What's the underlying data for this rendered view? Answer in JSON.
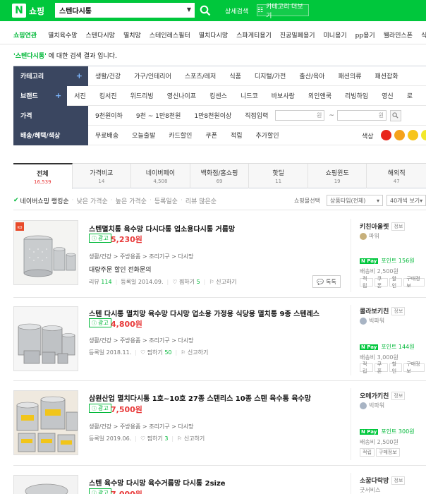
{
  "header": {
    "logo_text": "쇼핑",
    "search_query": "스텐다시통",
    "detail_search": "상세검색",
    "category_button": "카테고리 더보기"
  },
  "related": {
    "title": "쇼핑연관",
    "items": [
      "멸치육수망",
      "스텐다시망",
      "멸치망",
      "스테인레스필터",
      "멸치다시망",
      "스파게티용기",
      "진공밀폐용기",
      "미니용기",
      "pp용기",
      "웰라민스폰",
      "식품"
    ]
  },
  "result_message": {
    "query": "'스텐다시통'",
    "suffix": " 에 대한 검색 결과 입니다."
  },
  "filters": {
    "category": {
      "label": "카테고리",
      "items": [
        "생활/건강",
        "가구/인테리어",
        "스포츠/레저",
        "식품",
        "디지털/가전",
        "출산/육아",
        "패션의류",
        "패션잡화"
      ]
    },
    "brand": {
      "label": "브랜드",
      "items": [
        "서진",
        "킹서진",
        "위드리빙",
        "영신나이프",
        "킹센스",
        "니드코",
        "바보사랑",
        "외인앤쿡",
        "리빙하임",
        "영신",
        "로"
      ]
    },
    "price": {
      "label": "가격",
      "items": [
        "9천원이하",
        "9천 ~ 1만8천원",
        "1만8천원이상",
        "직접입력"
      ],
      "unit": "원",
      "tilde": "~"
    },
    "delivery": {
      "label": "배송/혜택/색상",
      "items": [
        "무료배송",
        "오늘출발",
        "카드할인",
        "쿠폰",
        "적립",
        "추가할인"
      ],
      "color_label": "색상"
    },
    "swatches": [
      "#e8261c",
      "#f5a21b",
      "#f7c51a",
      "#f2e82a"
    ]
  },
  "tabs": [
    {
      "label": "전체",
      "count": "16,539"
    },
    {
      "label": "가격비교",
      "count": "14"
    },
    {
      "label": "네이버페이",
      "count": "4,508"
    },
    {
      "label": "백화점/홈쇼핑",
      "count": "69"
    },
    {
      "label": "핫딜",
      "count": "11"
    },
    {
      "label": "쇼핑윈도",
      "count": "19"
    },
    {
      "label": "해외직",
      "count": "47"
    }
  ],
  "sort": {
    "active": "네이버쇼핑 랭킹순",
    "items": [
      "낮은 가격순",
      "높은 가격순",
      "등록일순",
      "리뷰 많은순"
    ],
    "filter_select": "쇼핑몰선택",
    "type_select": "상품타입(전체)",
    "view_select": "40개씩 보기"
  },
  "products": [
    {
      "title": "스텐멸치통 육수망 다시다통 업소용다시통 거름망",
      "ad": "광고",
      "price": "5,230원",
      "category": [
        "생활/건강",
        "주방용품",
        "조리기구",
        "다시망"
      ],
      "promo": "대량주문 할인 전화문의",
      "review_label": "리뷰",
      "review_count": "114",
      "date": "등록일 2014.09.",
      "wish_label": "찜하기",
      "wish_count": "5",
      "report": "신고하기",
      "talk": "톡톡",
      "seller": "키친아울렛",
      "grade": "파워",
      "grade_color": "#c7b07b",
      "npay_point": "포인트 156원",
      "shipping": "배송비 2,500원",
      "tags": [
        "적립",
        "쿠폰",
        "할인",
        "구매정보"
      ],
      "info": "정보"
    },
    {
      "title": "스텐 다시통 멸치망 육수망 다시망 업소용 가정용 식당용 멸치통 9종 스텐레스",
      "ad": "광고",
      "price": "4,800원",
      "category": [
        "생활/건강",
        "주방용품",
        "조리기구",
        "다시망"
      ],
      "date": "등록일 2018.11.",
      "wish_label": "찜하기",
      "wish_count": "50",
      "report": "신고하기",
      "seller": "콜라보키친",
      "grade": "빅파워",
      "grade_color": "#a8b4c4",
      "npay_point": "포인트 144원",
      "shipping": "배송비 3,000원",
      "tags": [
        "적립",
        "쿠폰",
        "할인",
        "구매정보"
      ],
      "info": "정보"
    },
    {
      "title": "삼원산업 멸치다시통 1호~10호 27종 스텐리스 10종 스텐 육수통 육수망",
      "ad": "광고",
      "price": "7,500원",
      "category": [
        "생활/건강",
        "주방용품",
        "조리기구",
        "다시망"
      ],
      "date": "등록일 2019.06.",
      "wish_label": "찜하기",
      "wish_count": "3",
      "report": "신고하기",
      "seller": "오메가키친",
      "grade": "빅파워",
      "grade_color": "#a8b4c4",
      "npay_point": "포인트 300원",
      "shipping": "배송비 2,500원",
      "tags": [
        "적립",
        "구매정보"
      ],
      "info": "정보"
    },
    {
      "title": "스텐 육수망 다시망 육수거름망 다시통 2size",
      "ad": "광고",
      "price": "7,000원",
      "seller": "소꿉다락방",
      "grade": "굿서비스",
      "info": "정보"
    }
  ]
}
